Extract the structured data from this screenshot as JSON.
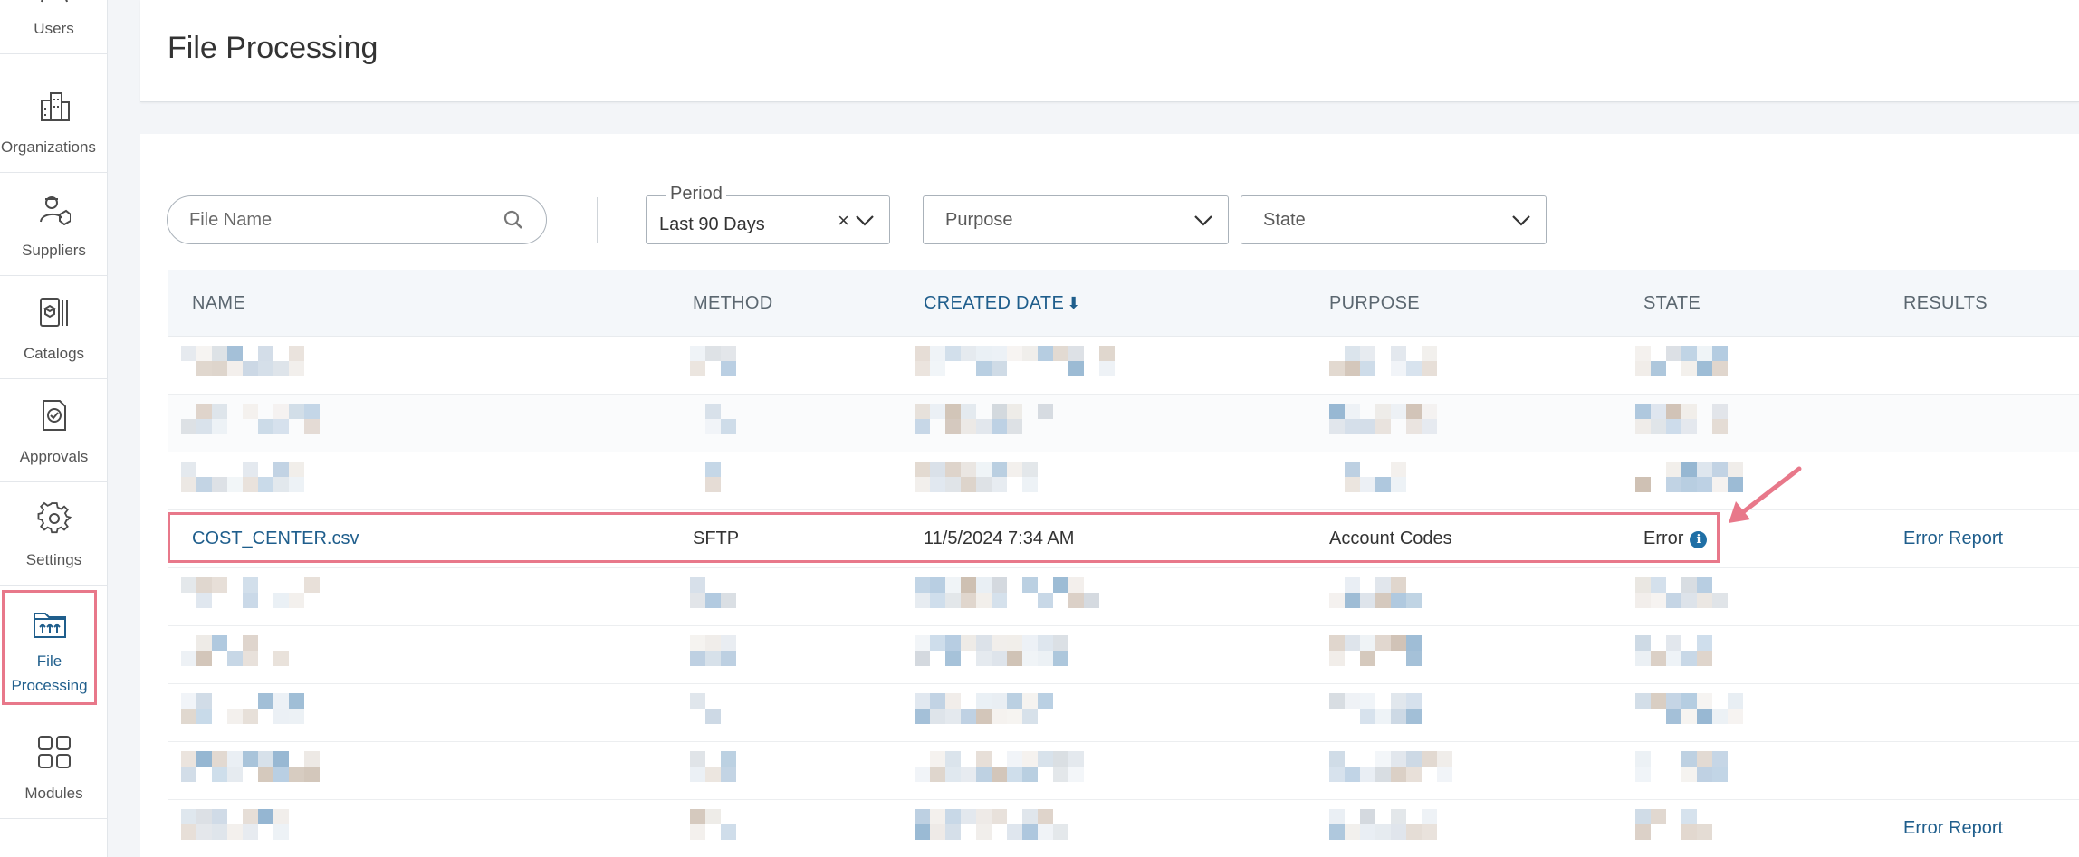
{
  "sidebar": {
    "items": [
      {
        "label": "Users",
        "icon": "users-icon"
      },
      {
        "label": "Organizations",
        "icon": "building-icon"
      },
      {
        "label": "Suppliers",
        "icon": "supplier-icon"
      },
      {
        "label": "Catalogs",
        "icon": "catalog-icon"
      },
      {
        "label": "Approvals",
        "icon": "approval-icon"
      },
      {
        "label": "Settings",
        "icon": "gear-icon"
      },
      {
        "label": "File Processing",
        "icon": "folder-upload-icon",
        "active": true
      },
      {
        "label": "Modules",
        "icon": "grid-icon"
      }
    ]
  },
  "header": {
    "title": "File Processing"
  },
  "filters": {
    "file_name_placeholder": "File Name",
    "period_label": "Period",
    "period_value": "Last 90 Days",
    "period_clear": "×",
    "purpose_placeholder": "Purpose",
    "state_placeholder": "State"
  },
  "table": {
    "columns": {
      "name": "NAME",
      "method": "METHOD",
      "created_date": "CREATED DATE",
      "purpose": "PURPOSE",
      "state": "STATE",
      "results": "RESULTS"
    },
    "sort_indicator": "🡇",
    "highlighted_row": {
      "name": "COST_CENTER.csv",
      "method": "SFTP",
      "created_date": "11/5/2024 7:34 AM",
      "purpose": "Account Codes",
      "state": "Error",
      "info": "i",
      "results": "Error Report"
    },
    "last_row_results": "Error Report"
  },
  "colors": {
    "accent": "#1f5e8c",
    "highlight": "#e8788a",
    "info": "#1f6fa6"
  }
}
